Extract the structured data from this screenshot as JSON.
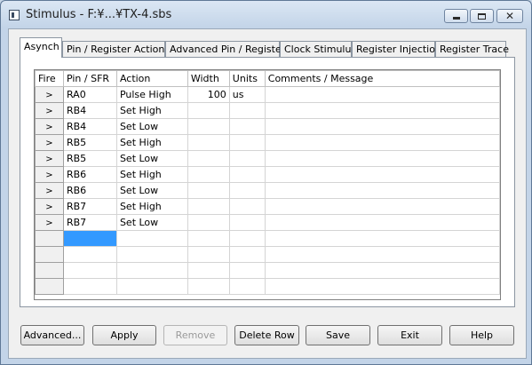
{
  "window": {
    "title": "Stimulus - F:¥...¥TX-4.sbs"
  },
  "tabs": [
    {
      "label": "Asynch",
      "active": true
    },
    {
      "label": "Pin / Register Actions",
      "active": false
    },
    {
      "label": "Advanced Pin / Register",
      "active": false
    },
    {
      "label": "Clock Stimulus",
      "active": false
    },
    {
      "label": "Register Injection",
      "active": false
    },
    {
      "label": "Register Trace",
      "active": false
    }
  ],
  "grid": {
    "columns": [
      "Fire",
      "Pin / SFR",
      "Action",
      "Width",
      "Units",
      "Comments / Message"
    ],
    "fire_glyph": ">",
    "rows": [
      {
        "pin": "RA0",
        "action": "Pulse High",
        "width": "100",
        "units": "us",
        "comment": ""
      },
      {
        "pin": "RB4",
        "action": "Set High",
        "width": "",
        "units": "",
        "comment": ""
      },
      {
        "pin": "RB4",
        "action": "Set Low",
        "width": "",
        "units": "",
        "comment": ""
      },
      {
        "pin": "RB5",
        "action": "Set High",
        "width": "",
        "units": "",
        "comment": ""
      },
      {
        "pin": "RB5",
        "action": "Set Low",
        "width": "",
        "units": "",
        "comment": ""
      },
      {
        "pin": "RB6",
        "action": "Set High",
        "width": "",
        "units": "",
        "comment": ""
      },
      {
        "pin": "RB6",
        "action": "Set Low",
        "width": "",
        "units": "",
        "comment": ""
      },
      {
        "pin": "RB7",
        "action": "Set High",
        "width": "",
        "units": "",
        "comment": ""
      },
      {
        "pin": "RB7",
        "action": "Set Low",
        "width": "",
        "units": "",
        "comment": ""
      }
    ],
    "empty_rows": 4
  },
  "buttons": {
    "advanced": "Advanced...",
    "apply": "Apply",
    "remove": "Remove",
    "delete_row": "Delete Row",
    "save": "Save",
    "exit": "Exit",
    "help": "Help"
  },
  "colors": {
    "selection": "#3399ff",
    "titlebar": "#c3d4e8"
  }
}
